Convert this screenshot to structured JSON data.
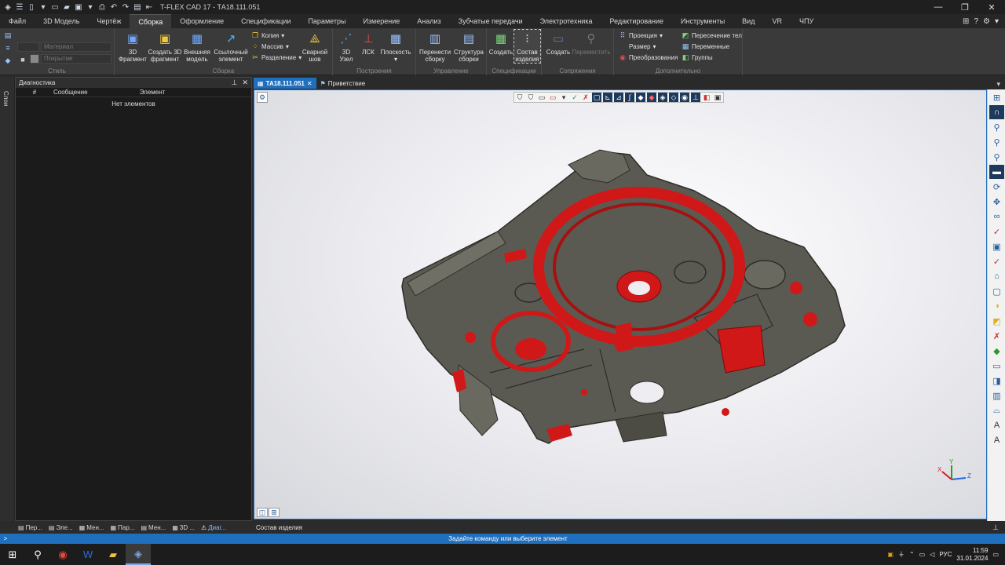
{
  "window": {
    "title": "T-FLEX CAD 17 - ТА18.111.051",
    "minimize": "—",
    "restore": "❐",
    "close": "✕"
  },
  "menu": {
    "tabs": [
      "Файл",
      "3D Модель",
      "Чертёж",
      "Сборка",
      "Оформление",
      "Спецификации",
      "Параметры",
      "Измерение",
      "Анализ",
      "Зубчатые передачи",
      "Электротехника",
      "Редактирование",
      "Инструменты",
      "Вид",
      "VR",
      "ЧПУ"
    ],
    "active": "Сборка"
  },
  "ribbon": {
    "style": {
      "label": "Стиль",
      "material": "Материал",
      "coating": "Покрытие"
    },
    "assembly": {
      "label": "Сборка",
      "fragment3d": "3D\nФрагмент",
      "create_fragment": "Создать 3D\nфрагмент",
      "external_model": "Внешняя\nмодель",
      "linked_element": "Ссылочный\nэлемент",
      "copy": "Копия",
      "array": "Массив",
      "split": "Разделение",
      "weld": "Сварной\nшов"
    },
    "construction": {
      "label": "Построения",
      "node3d": "3D\nУзел",
      "lcs": "ЛСК",
      "plane": "Плоскость"
    },
    "management": {
      "label": "Управление",
      "move_assembly": "Перенести\nсборку",
      "assembly_structure": "Структура\nсборки"
    },
    "specifications": {
      "label": "Спецификации",
      "create": "Создать",
      "bom": "Состав\nизделия"
    },
    "mates": {
      "label": "Сопряжения",
      "create": "Создать",
      "move": "Переместить"
    },
    "additional": {
      "label": "Дополнительно",
      "projection": "Проекция",
      "size": "Размер",
      "transforms": "Преобразования",
      "intersection": "Пересечение тел",
      "variables": "Переменные",
      "groups": "Группы"
    }
  },
  "left_strip": {
    "vertical_tab": "Слои"
  },
  "diagnostics": {
    "title": "Диагностика",
    "columns": [
      "#",
      "Сообщение",
      "Элемент"
    ],
    "empty": "Нет элементов"
  },
  "doc_tabs": [
    {
      "label": "ТА18.111.051",
      "active": true
    },
    {
      "label": "Приветствие",
      "active": false
    }
  ],
  "panel_tabs": [
    "Пер...",
    "Эле...",
    "Мен...",
    "Пар...",
    "Мен...",
    "3D ...",
    "Диаг..."
  ],
  "bottom_bar": {
    "label": "Состав изделия"
  },
  "status": {
    "message": "Задайте команду или выберите элемент",
    "arrow": ">"
  },
  "taskbar": {
    "lang": "РУС",
    "time": "11:59",
    "date": "31.01.2024"
  },
  "triad": {
    "x": "X",
    "y": "Y",
    "z": "Z"
  },
  "colors": {
    "accent": "#1f6fbf",
    "model_body": "#5b5a52",
    "model_highlight": "#d01818"
  }
}
